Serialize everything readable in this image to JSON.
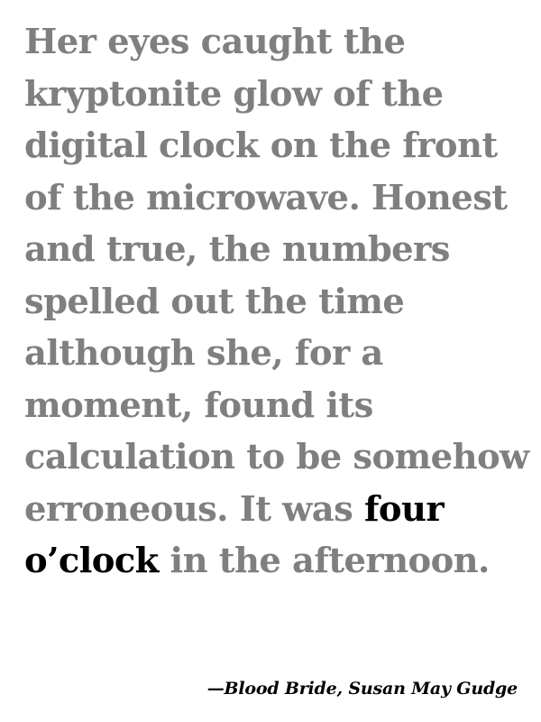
{
  "quote": {
    "line1": "Her eyes caught the",
    "line2": "kryptonite glow of the",
    "line3": "digital clock on the front",
    "line4": "of the microwave. Honest",
    "line5": "and true, the numbers",
    "line6": "spelled out the time",
    "line7": "although she, for a",
    "line8": "moment, found its",
    "line9": "calculation to be somehow",
    "line10_before": "erroneous. It was ",
    "line10_highlight": "four",
    "line11_highlight": "o’clock",
    "line11_after": " in the afternoon."
  },
  "attribution": {
    "text": "—Blood Bride, Susan May Gudge"
  },
  "colors": {
    "body_text": "#7f7f7f",
    "highlight_text": "#000000",
    "background": "#ffffff"
  }
}
